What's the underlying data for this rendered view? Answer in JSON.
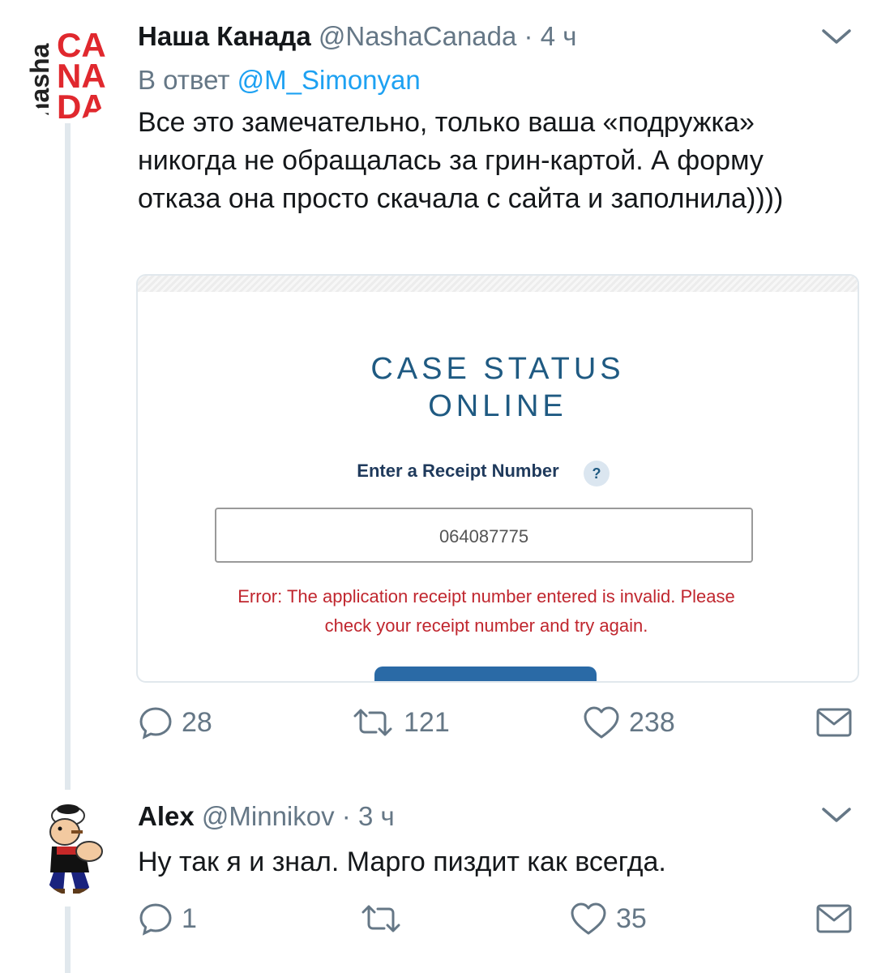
{
  "tweets": [
    {
      "name": "Наша Канада",
      "handle": "@NashaCanada",
      "separator": "·",
      "time": "4 ч",
      "reply_prefix": "В ответ",
      "reply_to": "@M_Simonyan",
      "text": "Все это замечательно, только ваша «подружка» никогда не обращалась за грин-картой. А форму отказа она просто скачала с сайта и заполнила))))",
      "counts": {
        "reply": "28",
        "retweet": "121",
        "like": "238"
      },
      "avatar_logo": {
        "line1": "CA",
        "line2": "NA",
        "line3": "DA",
        "side": "nasha"
      }
    },
    {
      "name": "Alex",
      "handle": "@Minnikov",
      "separator": "·",
      "time": "3 ч",
      "text": "Ну так я и знал. Марго пиздит как всегда.",
      "counts": {
        "reply": "1",
        "retweet": "",
        "like": "35"
      }
    }
  ],
  "card": {
    "title_line1": "CASE STATUS",
    "title_line2": "ONLINE",
    "receipt_label": "Enter a Receipt Number",
    "help_symbol": "?",
    "receipt_value": "064087775",
    "error_line1": "Error: The application receipt number entered is invalid. Please",
    "error_line2": "check your receipt number and try again."
  },
  "colors": {
    "mention": "#1da1f2",
    "muted": "#657786",
    "card_title": "#1f5a82",
    "error": "#c0262e",
    "logo_red": "#e0282e"
  },
  "icons": [
    "reply-icon",
    "retweet-icon",
    "like-icon",
    "dm-icon",
    "chevron-down-icon"
  ]
}
